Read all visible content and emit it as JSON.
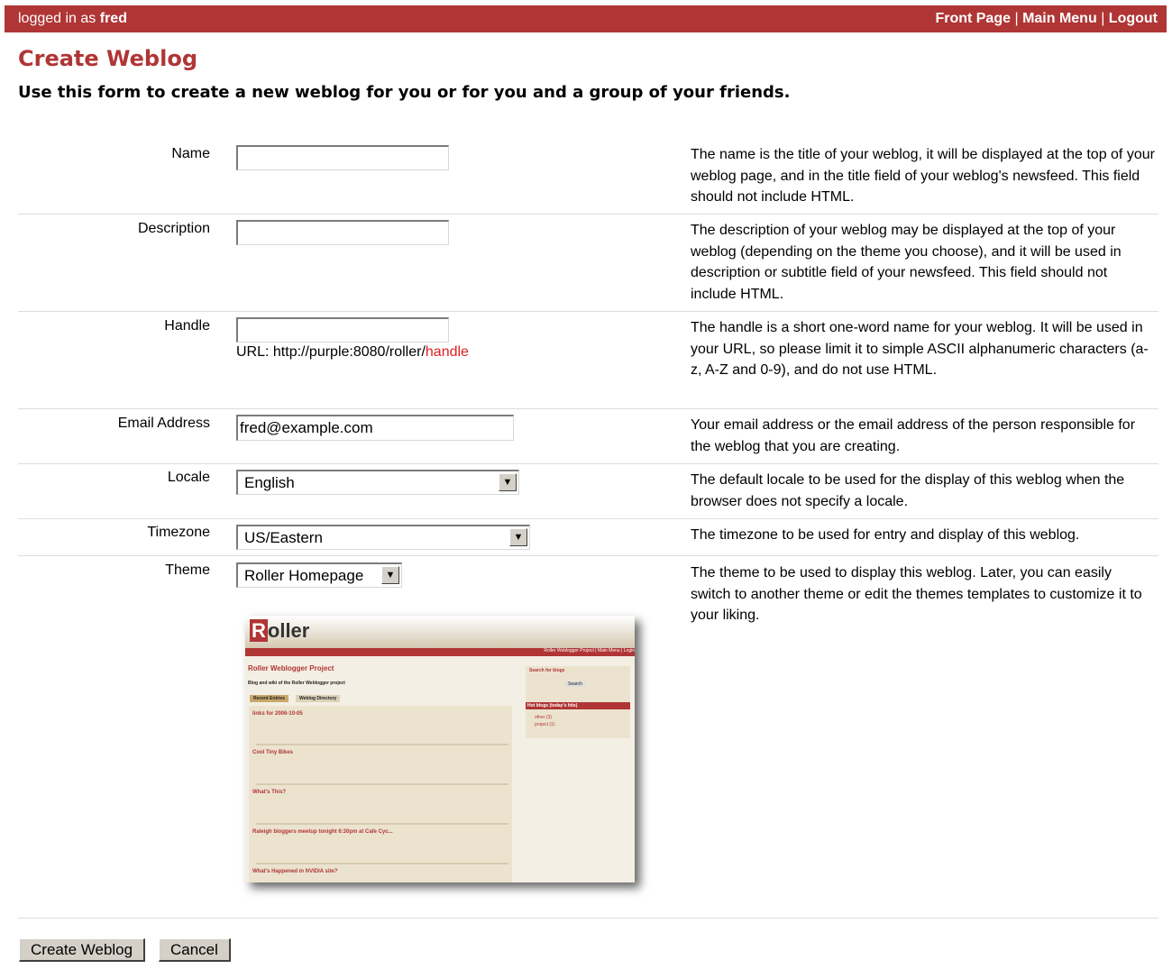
{
  "topbar": {
    "logged_in_prefix": "logged in as",
    "username": "fred",
    "links": [
      "Front Page",
      "Main Menu",
      "Logout"
    ],
    "separator": "|"
  },
  "page": {
    "title": "Create Weblog",
    "subtitle": "Use this form to create a new weblog for you or for you and a group of your friends."
  },
  "form": {
    "name": {
      "label": "Name",
      "value": "",
      "help": "The name is the title of your weblog, it will be displayed at the top of your weblog page, and in the title field of your weblog's newsfeed. This field should not include HTML."
    },
    "description": {
      "label": "Description",
      "value": "",
      "help": "The description of your weblog may be displayed at the top of your weblog (depending on the theme you choose), and it will be used in description or subtitle field of your newsfeed. This field should not include HTML."
    },
    "handle": {
      "label": "Handle",
      "value": "",
      "url_prefix": "URL:  http://purple:8080/roller/",
      "url_placeholder": "handle",
      "help": "The handle is a short one-word name for your weblog. It will be used in your URL, so please limit it to simple ASCII alphanumeric characters (a-z, A-Z and 0-9), and do not use HTML."
    },
    "email": {
      "label": "Email Address",
      "value": "fred@example.com",
      "help": "Your email address or the email address of the person responsible for the weblog that you are creating."
    },
    "locale": {
      "label": "Locale",
      "value": "English",
      "help": "The default locale to be used for the display of this weblog when the browser does not specify a locale."
    },
    "timezone": {
      "label": "Timezone",
      "value": "US/Eastern",
      "help": "The timezone to be used for entry and display of this weblog."
    },
    "theme": {
      "label": "Theme",
      "value": "Roller Homepage",
      "help": "The theme to be used to display this weblog. Later, you can easily switch to another theme or edit the themes templates to customize it to your liking."
    }
  },
  "preview": {
    "logo_first": "R",
    "logo_rest": "oller",
    "nav": "Roller Weblogger Project | Main Menu | Login",
    "title": "Roller Weblogger Project",
    "tagline": "Blog and wiki of the Roller Weblogger project",
    "tabs": [
      "Recent Entries",
      "Weblog Directory"
    ],
    "posts": [
      "links for 2006-10-05",
      "Cool Tiny Bikes",
      "What's This?",
      "Raleigh bloggers meetup tonight 6:30pm at Cafe Cyc...",
      "What's Happened in NVIDIA site?"
    ],
    "side_search": "Search for blogs",
    "side_search_btn": "Search",
    "side_hot": "Hot blogs (today's hits)",
    "side_items": [
      "other (3)",
      "project (1)"
    ]
  },
  "buttons": {
    "create": "Create Weblog",
    "cancel": "Cancel"
  }
}
